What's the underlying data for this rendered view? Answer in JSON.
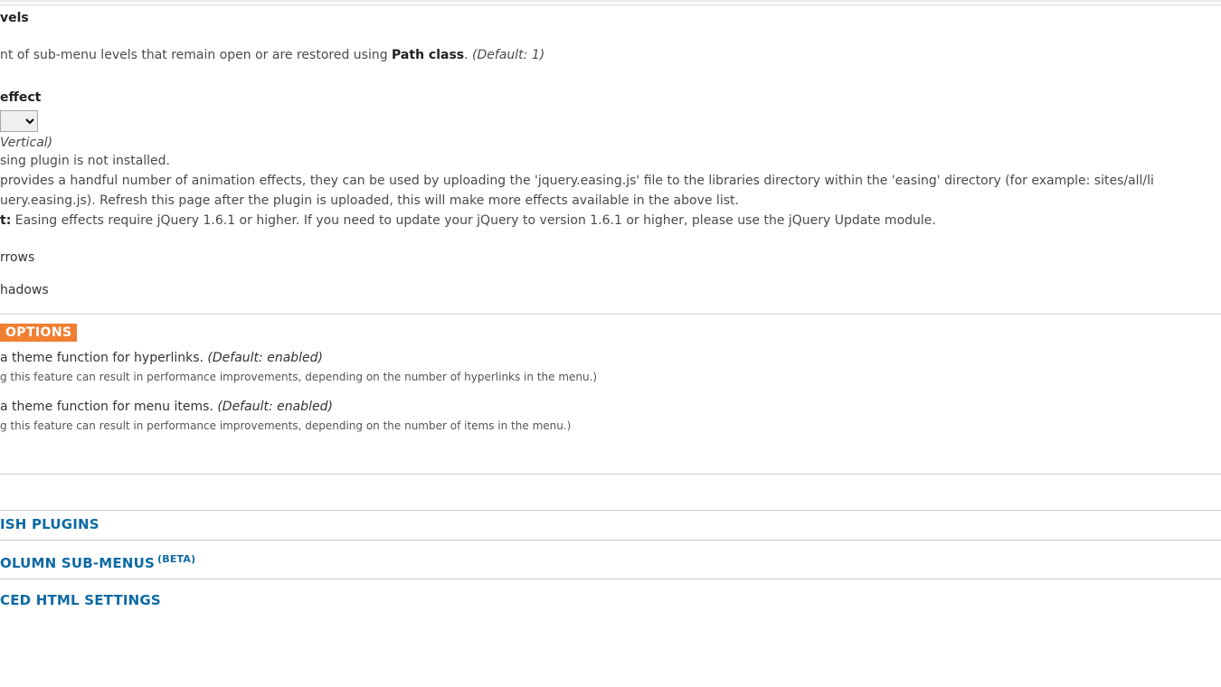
{
  "levels": {
    "title_fragment": "vels",
    "desc_prefix": "nt of sub-menu levels that remain open or are restored using ",
    "desc_strong": "Path class",
    "desc_suffix": ". ",
    "desc_default": "(Default: 1)"
  },
  "effect": {
    "title_fragment": " effect",
    "default_label": "Vertical)",
    "plugin_missing": "sing plugin is not installed.",
    "plugin_help1": " provides a handful number of animation effects, they can be used by uploading the 'jquery.easing.js' file to the libraries directory within the 'easing' directory (for example: sites/all/li",
    "plugin_help2": "uery.easing.js). Refresh this page after the plugin is uploaded, this will make more effects available in the above list.",
    "important_label": "t:",
    "important_text": " Easing effects require jQuery 1.6.1 or higher. If you need to update your jQuery to version 1.6.1 or higher, please use the jQuery Update module."
  },
  "arrows_label": "rrows",
  "shadows_label": "hadows",
  "advanced_options": {
    "badge": " OPTIONS",
    "hyperlinks_main": " a theme function for hyperlinks. ",
    "hyperlinks_default": "(Default: enabled)",
    "hyperlinks_sub": "g this feature can result in performance improvements, depending on the number of hyperlinks in the menu.)",
    "menuitems_main": " a theme function for menu items. ",
    "menuitems_default": "(Default: enabled)",
    "menuitems_sub": "g this feature can result in performance improvements, depending on the number of items in the menu.)"
  },
  "accordions": {
    "plugins": "ISH PLUGINS",
    "multicolumn": "OLUMN SUB-MENUS",
    "multicolumn_beta": "(BETA)",
    "advanced_html": "CED HTML SETTINGS"
  }
}
